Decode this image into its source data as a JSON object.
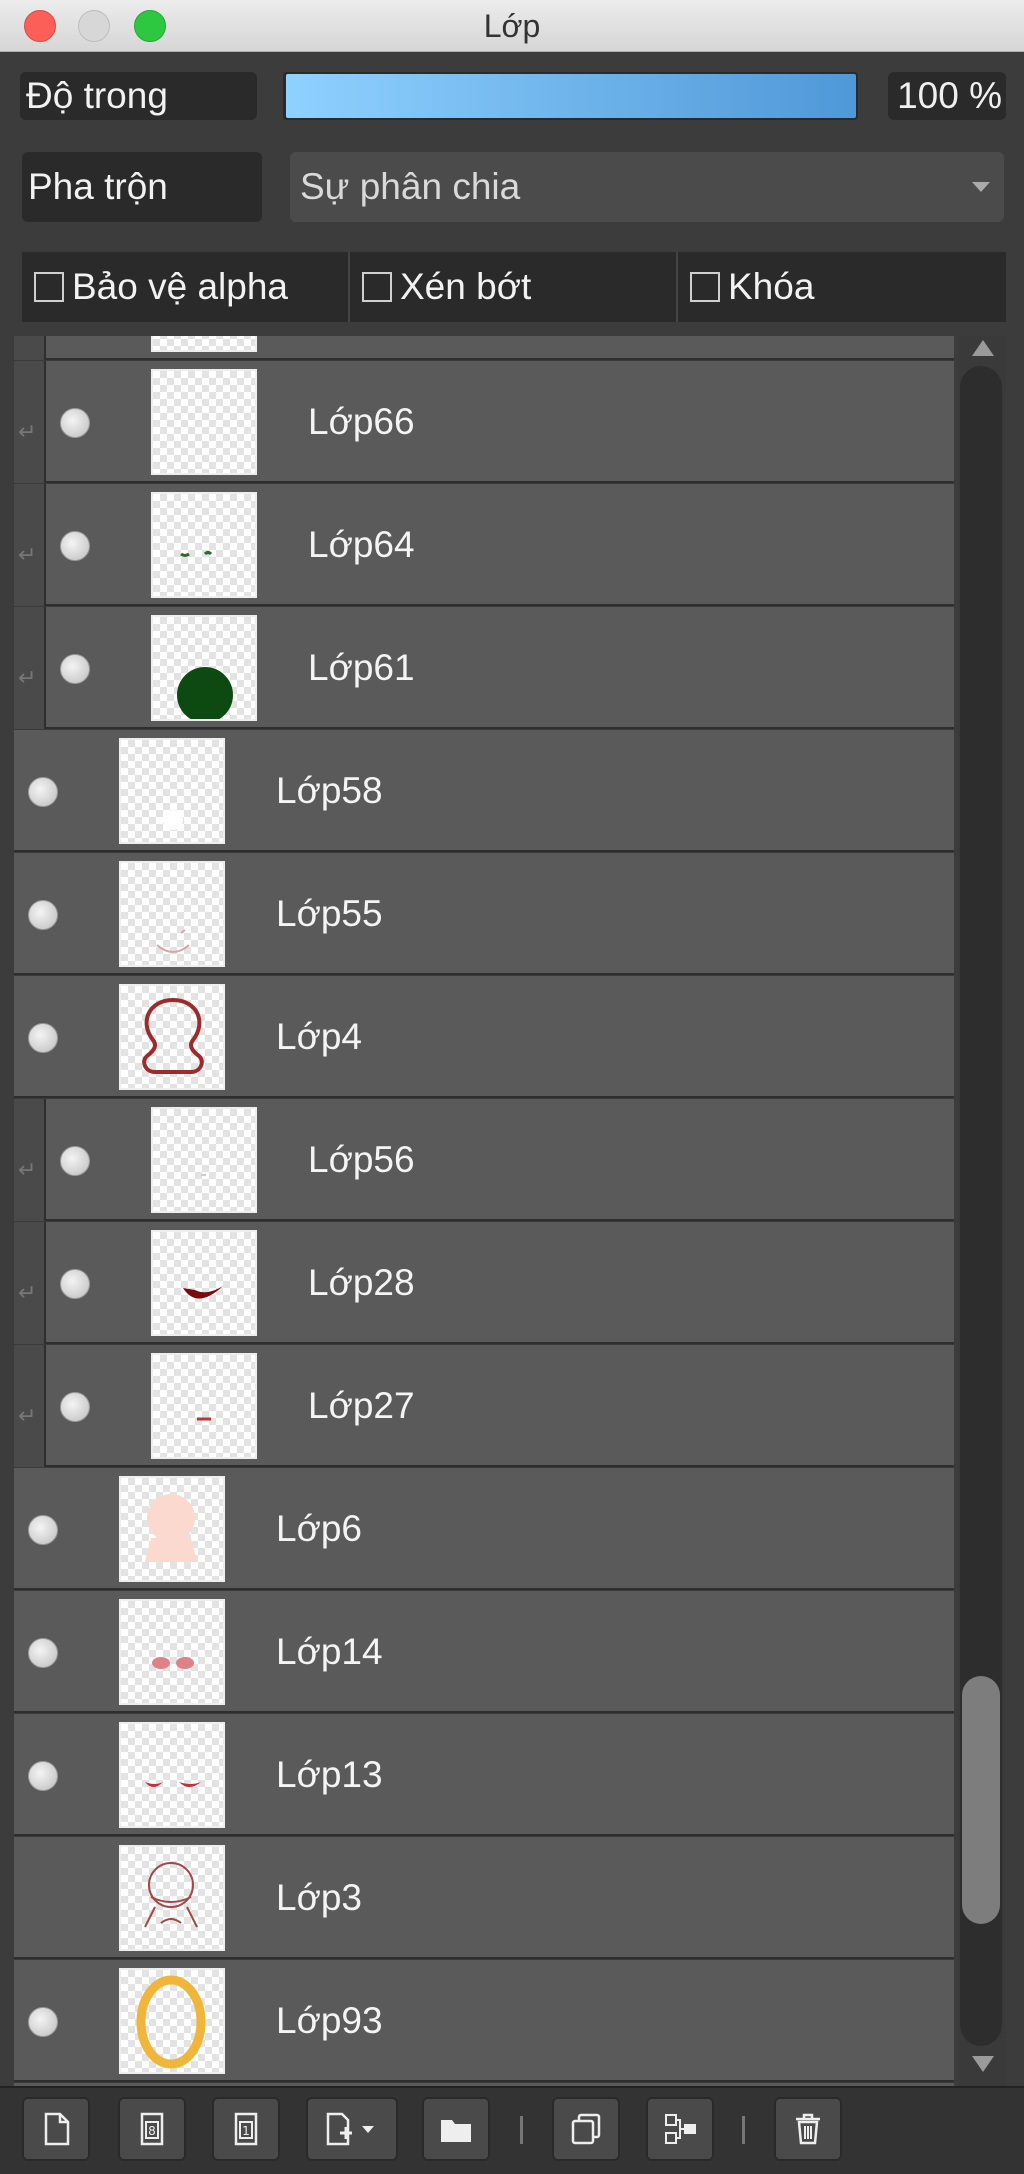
{
  "window": {
    "title": "Lớp"
  },
  "opacity": {
    "label": "Độ trong",
    "value": "100 %",
    "level_percent": 100
  },
  "blend": {
    "label": "Pha trộn",
    "value": "Sự phân chia"
  },
  "options": [
    {
      "label": "Bảo vệ alpha",
      "checked": false
    },
    {
      "label": "Xén bớt",
      "checked": false
    },
    {
      "label": "Khóa",
      "checked": false
    }
  ],
  "layers": [
    {
      "name": "",
      "nested": true,
      "visible": false,
      "thumb": "partial"
    },
    {
      "name": "Lớp66",
      "nested": true,
      "visible": true,
      "thumb": "empty"
    },
    {
      "name": "Lớp64",
      "nested": true,
      "visible": true,
      "thumb": "green-strokes"
    },
    {
      "name": "Lớp61",
      "nested": true,
      "visible": true,
      "thumb": "green-circle"
    },
    {
      "name": "Lớp58",
      "nested": false,
      "visible": true,
      "thumb": "white-blob"
    },
    {
      "name": "Lớp55",
      "nested": false,
      "visible": true,
      "thumb": "faint-smile"
    },
    {
      "name": "Lớp4",
      "nested": false,
      "visible": true,
      "thumb": "head-outline"
    },
    {
      "name": "Lớp56",
      "nested": true,
      "visible": true,
      "thumb": "tiny-mark"
    },
    {
      "name": "Lớp28",
      "nested": true,
      "visible": true,
      "thumb": "red-mouth"
    },
    {
      "name": "Lớp27",
      "nested": true,
      "visible": true,
      "thumb": "small-red"
    },
    {
      "name": "Lớp6",
      "nested": false,
      "visible": true,
      "thumb": "skin-head"
    },
    {
      "name": "Lớp14",
      "nested": false,
      "visible": true,
      "thumb": "pink-cheeks"
    },
    {
      "name": "Lớp13",
      "nested": false,
      "visible": true,
      "thumb": "red-eyes"
    },
    {
      "name": "Lớp3",
      "nested": false,
      "visible": false,
      "thumb": "sketch"
    },
    {
      "name": "Lớp93",
      "nested": false,
      "visible": true,
      "thumb": "yellow-ring"
    },
    {
      "name": "",
      "nested": false,
      "visible": false,
      "thumb": "partial"
    }
  ],
  "toolbar": [
    {
      "icon": "new-layer-icon"
    },
    {
      "icon": "new-8bit-layer-icon"
    },
    {
      "icon": "new-1bit-layer-icon"
    },
    {
      "icon": "add-layer-dropdown-icon"
    },
    {
      "icon": "folder-icon"
    },
    {
      "icon": "duplicate-layer-icon"
    },
    {
      "icon": "merge-down-icon"
    },
    {
      "icon": "trash-icon"
    }
  ]
}
